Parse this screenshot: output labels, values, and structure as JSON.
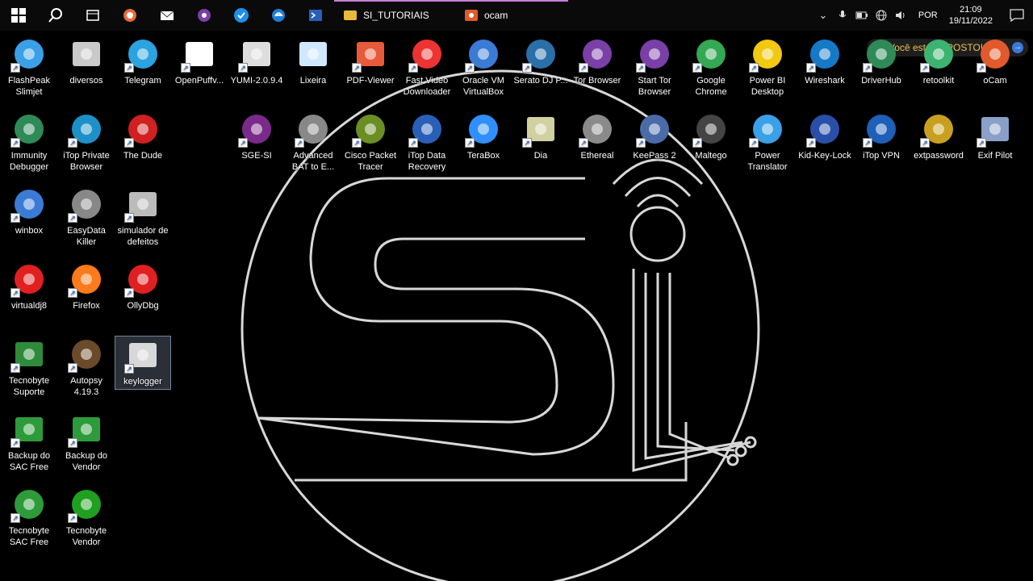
{
  "taskbar": {
    "buttons": [
      {
        "name": "start-icon"
      },
      {
        "name": "search-icon"
      },
      {
        "name": "task-view-icon"
      },
      {
        "name": "app-icon-1"
      },
      {
        "name": "mail-icon"
      },
      {
        "name": "tor-icon"
      },
      {
        "name": "vpn-icon"
      },
      {
        "name": "edge-icon"
      },
      {
        "name": "powershell-icon"
      }
    ],
    "apps": [
      {
        "label": "SI_TUTORIAIS"
      },
      {
        "label": "ocam"
      }
    ],
    "tray": {
      "language": "POR",
      "time": "21:09",
      "date": "19/11/2022"
    }
  },
  "notification": {
    "text": "Você está EXPOSTO!"
  },
  "desktop": {
    "icons": [
      {
        "label": "FlashPeak Slimjet",
        "icon": "slimjet-icon",
        "color": "#3aa0e8"
      },
      {
        "label": "diversos",
        "icon": "folder-icon",
        "color": "#c9c9c9"
      },
      {
        "label": "Telegram",
        "icon": "telegram-icon",
        "color": "#2aa3e0"
      },
      {
        "label": "OpenPuffv...",
        "icon": "openpuff-icon",
        "color": "#ffffff"
      },
      {
        "label": "YUMI-2.0.9.4",
        "icon": "usb-icon",
        "color": "#dddddd"
      },
      {
        "label": "Lixeira",
        "icon": "recycle-bin-icon",
        "color": "#cfe8ff"
      },
      {
        "label": "PDF-Viewer",
        "icon": "pdf-icon",
        "color": "#e85a3a"
      },
      {
        "label": "Fast Video Downloader",
        "icon": "video-downloader-icon",
        "color": "#e33"
      },
      {
        "label": "Oracle VM VirtualBox",
        "icon": "virtualbox-icon",
        "color": "#3a7bd5"
      },
      {
        "label": "Serato DJ P...",
        "icon": "serato-icon",
        "color": "#2a6fa8"
      },
      {
        "label": "Tor Browser",
        "icon": "tor-browser-icon",
        "color": "#7b3fa8"
      },
      {
        "label": "Start Tor Browser",
        "icon": "start-tor-icon",
        "color": "#7b3fa8"
      },
      {
        "label": "Google Chrome",
        "icon": "chrome-icon",
        "color": "#34a853"
      },
      {
        "label": "Power BI Desktop",
        "icon": "powerbi-icon",
        "color": "#f2c811"
      },
      {
        "label": "Wireshark",
        "icon": "wireshark-icon",
        "color": "#1679c8"
      },
      {
        "label": "DriverHub",
        "icon": "driverhub-icon",
        "color": "#2e8b57"
      },
      {
        "label": "retoolkit",
        "icon": "retoolkit-icon",
        "color": "#3cb371"
      },
      {
        "label": "oCam",
        "icon": "ocam-icon",
        "color": "#e05a2b"
      },
      {
        "label": "Immunity Debugger",
        "icon": "immunity-icon",
        "color": "#2e8b57"
      },
      {
        "label": "iTop Private Browser",
        "icon": "itop-browser-icon",
        "color": "#1e90c8"
      },
      {
        "label": "The Dude",
        "icon": "the-dude-icon",
        "color": "#d02020"
      },
      {
        "label": "SGE-SI",
        "icon": "sge-si-icon",
        "color": "#7a2a8a"
      },
      {
        "label": "Advanced BAT to E...",
        "icon": "bat-to-exe-icon",
        "color": "#888888"
      },
      {
        "label": "Cisco Packet Tracer",
        "icon": "packet-tracer-icon",
        "color": "#6b8e23"
      },
      {
        "label": "iTop Data Recovery",
        "icon": "itop-recovery-icon",
        "color": "#2a5fb8"
      },
      {
        "label": "TeraBox",
        "icon": "terabox-icon",
        "color": "#2f8fff"
      },
      {
        "label": "Dia",
        "icon": "dia-icon",
        "color": "#d0d0a0"
      },
      {
        "label": "Ethereal",
        "icon": "ethereal-icon",
        "color": "#8a8a8a"
      },
      {
        "label": "KeePass 2",
        "icon": "keepass-icon",
        "color": "#4a6aa8"
      },
      {
        "label": "Maltego",
        "icon": "maltego-icon",
        "color": "#444444"
      },
      {
        "label": "Power Translator",
        "icon": "globe-icon",
        "color": "#3aa0e8"
      },
      {
        "label": "Kid-Key-Lock",
        "icon": "kid-key-lock-icon",
        "color": "#2a4fa8"
      },
      {
        "label": "iTop VPN",
        "icon": "itop-vpn-icon",
        "color": "#1e5fb8"
      },
      {
        "label": "extpassword",
        "icon": "keys-icon",
        "color": "#c8a020"
      },
      {
        "label": "Exif Pilot",
        "icon": "exif-pilot-icon",
        "color": "#8aa0c8"
      },
      {
        "label": "winbox",
        "icon": "winbox-icon",
        "color": "#3a7bd5"
      },
      {
        "label": "EasyData Killer",
        "icon": "easydata-icon",
        "color": "#888888"
      },
      {
        "label": "simulador de defeitos",
        "icon": "simulator-icon",
        "color": "#bbbbbb"
      },
      {
        "label": "virtualdj8",
        "icon": "virtualdj-icon",
        "color": "#e02020"
      },
      {
        "label": "Firefox",
        "icon": "firefox-icon",
        "color": "#ff7a1a"
      },
      {
        "label": "OllyDbg",
        "icon": "ollydbg-icon",
        "color": "#e02020"
      },
      {
        "label": "Tecnobyte Suporte",
        "icon": "tecnobyte-suporte-icon",
        "color": "#2e8b3a"
      },
      {
        "label": "Autopsy 4.19.3",
        "icon": "autopsy-icon",
        "color": "#6b4a2a"
      },
      {
        "label": "keylogger",
        "icon": "keylogger-icon",
        "color": "#d8d8d8"
      },
      {
        "label": "Backup do SAC Free",
        "icon": "backup-sac-icon",
        "color": "#2e9b3a"
      },
      {
        "label": "Backup do Vendor",
        "icon": "backup-vendor-icon",
        "color": "#2e9b3a"
      },
      {
        "label": "Tecnobyte SAC Free",
        "icon": "tecnobyte-sac-icon",
        "color": "#2e9b3a"
      },
      {
        "label": "Tecnobyte Vendor",
        "icon": "tecnobyte-vendor-icon",
        "color": "#20a020"
      }
    ]
  }
}
